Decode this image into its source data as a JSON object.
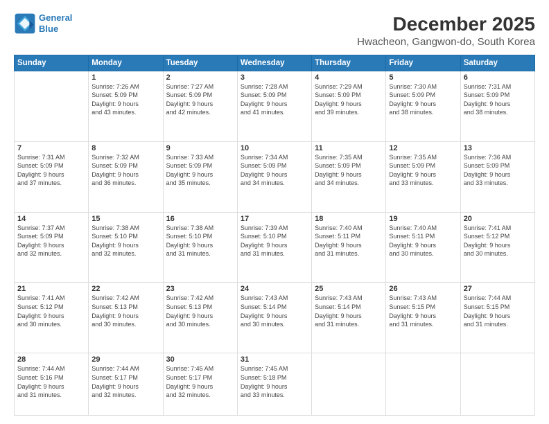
{
  "header": {
    "logo_line1": "General",
    "logo_line2": "Blue",
    "title": "December 2025",
    "subtitle": "Hwacheon, Gangwon-do, South Korea"
  },
  "weekdays": [
    "Sunday",
    "Monday",
    "Tuesday",
    "Wednesday",
    "Thursday",
    "Friday",
    "Saturday"
  ],
  "weeks": [
    [
      {
        "day": "",
        "detail": ""
      },
      {
        "day": "1",
        "detail": "Sunrise: 7:26 AM\nSunset: 5:09 PM\nDaylight: 9 hours\nand 43 minutes."
      },
      {
        "day": "2",
        "detail": "Sunrise: 7:27 AM\nSunset: 5:09 PM\nDaylight: 9 hours\nand 42 minutes."
      },
      {
        "day": "3",
        "detail": "Sunrise: 7:28 AM\nSunset: 5:09 PM\nDaylight: 9 hours\nand 41 minutes."
      },
      {
        "day": "4",
        "detail": "Sunrise: 7:29 AM\nSunset: 5:09 PM\nDaylight: 9 hours\nand 39 minutes."
      },
      {
        "day": "5",
        "detail": "Sunrise: 7:30 AM\nSunset: 5:09 PM\nDaylight: 9 hours\nand 38 minutes."
      },
      {
        "day": "6",
        "detail": "Sunrise: 7:31 AM\nSunset: 5:09 PM\nDaylight: 9 hours\nand 38 minutes."
      }
    ],
    [
      {
        "day": "7",
        "detail": "Sunrise: 7:31 AM\nSunset: 5:09 PM\nDaylight: 9 hours\nand 37 minutes."
      },
      {
        "day": "8",
        "detail": "Sunrise: 7:32 AM\nSunset: 5:09 PM\nDaylight: 9 hours\nand 36 minutes."
      },
      {
        "day": "9",
        "detail": "Sunrise: 7:33 AM\nSunset: 5:09 PM\nDaylight: 9 hours\nand 35 minutes."
      },
      {
        "day": "10",
        "detail": "Sunrise: 7:34 AM\nSunset: 5:09 PM\nDaylight: 9 hours\nand 34 minutes."
      },
      {
        "day": "11",
        "detail": "Sunrise: 7:35 AM\nSunset: 5:09 PM\nDaylight: 9 hours\nand 34 minutes."
      },
      {
        "day": "12",
        "detail": "Sunrise: 7:35 AM\nSunset: 5:09 PM\nDaylight: 9 hours\nand 33 minutes."
      },
      {
        "day": "13",
        "detail": "Sunrise: 7:36 AM\nSunset: 5:09 PM\nDaylight: 9 hours\nand 33 minutes."
      }
    ],
    [
      {
        "day": "14",
        "detail": "Sunrise: 7:37 AM\nSunset: 5:09 PM\nDaylight: 9 hours\nand 32 minutes."
      },
      {
        "day": "15",
        "detail": "Sunrise: 7:38 AM\nSunset: 5:10 PM\nDaylight: 9 hours\nand 32 minutes."
      },
      {
        "day": "16",
        "detail": "Sunrise: 7:38 AM\nSunset: 5:10 PM\nDaylight: 9 hours\nand 31 minutes."
      },
      {
        "day": "17",
        "detail": "Sunrise: 7:39 AM\nSunset: 5:10 PM\nDaylight: 9 hours\nand 31 minutes."
      },
      {
        "day": "18",
        "detail": "Sunrise: 7:40 AM\nSunset: 5:11 PM\nDaylight: 9 hours\nand 31 minutes."
      },
      {
        "day": "19",
        "detail": "Sunrise: 7:40 AM\nSunset: 5:11 PM\nDaylight: 9 hours\nand 30 minutes."
      },
      {
        "day": "20",
        "detail": "Sunrise: 7:41 AM\nSunset: 5:12 PM\nDaylight: 9 hours\nand 30 minutes."
      }
    ],
    [
      {
        "day": "21",
        "detail": "Sunrise: 7:41 AM\nSunset: 5:12 PM\nDaylight: 9 hours\nand 30 minutes."
      },
      {
        "day": "22",
        "detail": "Sunrise: 7:42 AM\nSunset: 5:13 PM\nDaylight: 9 hours\nand 30 minutes."
      },
      {
        "day": "23",
        "detail": "Sunrise: 7:42 AM\nSunset: 5:13 PM\nDaylight: 9 hours\nand 30 minutes."
      },
      {
        "day": "24",
        "detail": "Sunrise: 7:43 AM\nSunset: 5:14 PM\nDaylight: 9 hours\nand 30 minutes."
      },
      {
        "day": "25",
        "detail": "Sunrise: 7:43 AM\nSunset: 5:14 PM\nDaylight: 9 hours\nand 31 minutes."
      },
      {
        "day": "26",
        "detail": "Sunrise: 7:43 AM\nSunset: 5:15 PM\nDaylight: 9 hours\nand 31 minutes."
      },
      {
        "day": "27",
        "detail": "Sunrise: 7:44 AM\nSunset: 5:15 PM\nDaylight: 9 hours\nand 31 minutes."
      }
    ],
    [
      {
        "day": "28",
        "detail": "Sunrise: 7:44 AM\nSunset: 5:16 PM\nDaylight: 9 hours\nand 31 minutes."
      },
      {
        "day": "29",
        "detail": "Sunrise: 7:44 AM\nSunset: 5:17 PM\nDaylight: 9 hours\nand 32 minutes."
      },
      {
        "day": "30",
        "detail": "Sunrise: 7:45 AM\nSunset: 5:17 PM\nDaylight: 9 hours\nand 32 minutes."
      },
      {
        "day": "31",
        "detail": "Sunrise: 7:45 AM\nSunset: 5:18 PM\nDaylight: 9 hours\nand 33 minutes."
      },
      {
        "day": "",
        "detail": ""
      },
      {
        "day": "",
        "detail": ""
      },
      {
        "day": "",
        "detail": ""
      }
    ]
  ]
}
